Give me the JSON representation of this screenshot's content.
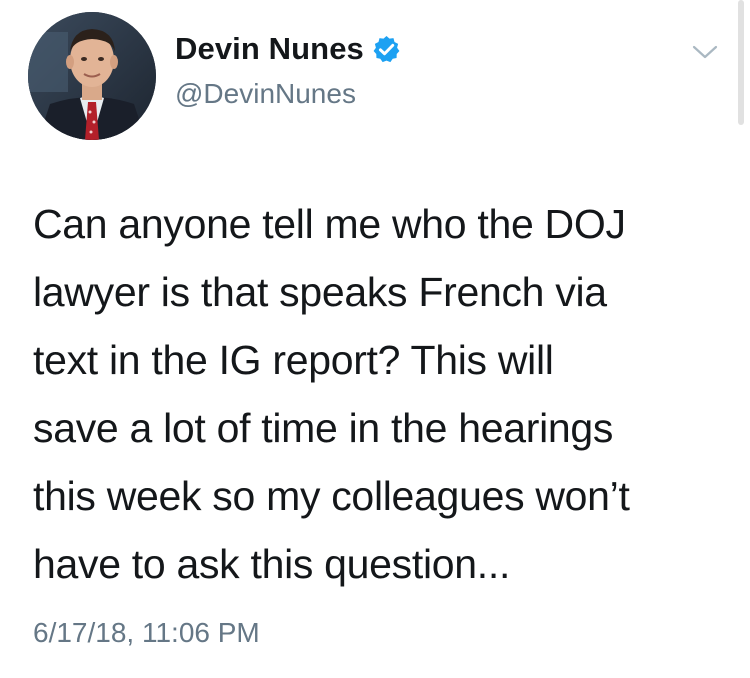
{
  "author": {
    "display_name": "Devin Nunes",
    "handle": "@DevinNunes",
    "verified": true,
    "avatar_icon": "profile-photo"
  },
  "tweet": {
    "text_lines": [
      "Can anyone tell me who the DOJ",
      "lawyer is that speaks French via",
      "text in the IG report?  This will",
      "save a lot of time in the hearings",
      "this week so my colleagues won’t",
      "have to ask this question..."
    ],
    "timestamp": "6/17/18, 11:06 PM"
  },
  "icons": {
    "verified": "verified-badge-icon",
    "menu": "chevron-down-icon"
  },
  "colors": {
    "text_primary": "#14171a",
    "text_secondary": "#657786",
    "verified_blue": "#1da1f2",
    "chevron": "#aab8c2"
  }
}
